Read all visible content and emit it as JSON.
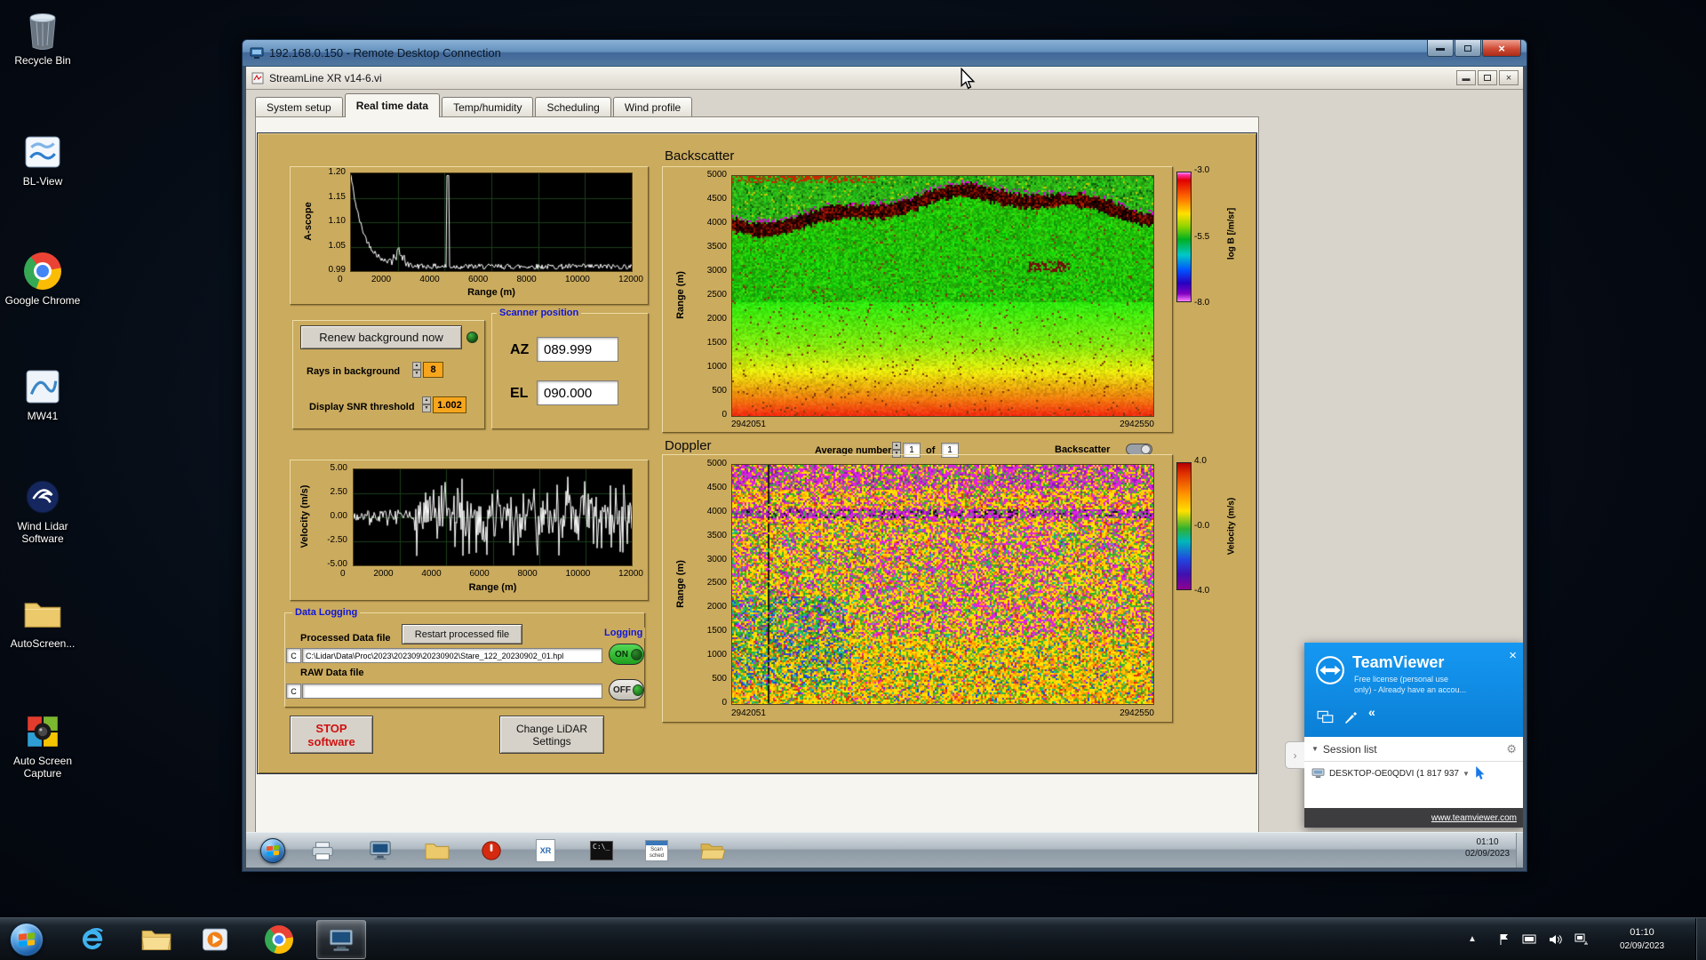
{
  "desktop": {
    "icons": [
      {
        "label": "Recycle Bin"
      },
      {
        "label": "BL-View"
      },
      {
        "label": "Google Chrome"
      },
      {
        "label": "MW41"
      },
      {
        "label": "Wind Lidar Software"
      },
      {
        "label": "AutoScreen..."
      },
      {
        "label": "Auto Screen Capture"
      }
    ]
  },
  "rdp": {
    "title": "192.168.0.150 - Remote Desktop Connection",
    "app_title": "StreamLine XR v14-6.vi",
    "tabs": [
      "System setup",
      "Real time data",
      "Temp/humidity",
      "Scheduling",
      "Wind profile"
    ],
    "active_tab": "Real time data"
  },
  "panel": {
    "backscatter_heading": "Backscatter",
    "doppler_heading": "Doppler",
    "renew_button": "Renew background now",
    "rays_label": "Rays in background",
    "rays_value": "8",
    "snr_label": "Display SNR threshold",
    "snr_value": "1.002",
    "scanner": {
      "title": "Scanner position",
      "az_label": "AZ",
      "az_value": "089.999",
      "el_label": "EL",
      "el_value": "090.000"
    },
    "average": {
      "label": "Average number",
      "first": "1",
      "of": "of",
      "second": "1"
    },
    "backscatter_toggle_label": "Backscatter",
    "logging": {
      "title": "Data Logging",
      "processed_label": "Processed Data file",
      "restart_button": "Restart processed file",
      "logging_label": "Logging",
      "drive": "C",
      "processed_path": "C:\\Lidar\\Data\\Proc\\2023\\202309\\20230902\\Stare_122_20230902_01.hpl",
      "on_label": "ON",
      "raw_label": "RAW Data file",
      "raw_path": "",
      "off_label": "OFF"
    },
    "stop_button": "STOP software",
    "change_button": "Change LiDAR Settings"
  },
  "charts": {
    "ascope": {
      "type": "line",
      "ylabel": "A-scope",
      "xlabel": "Range (m)",
      "yticks": [
        "1.20",
        "1.15",
        "1.10",
        "1.05",
        "0.99"
      ],
      "xticks": [
        "0",
        "2000",
        "4000",
        "6000",
        "8000",
        "10000",
        "12000"
      ]
    },
    "velocity": {
      "type": "line",
      "ylabel": "Velocity (m/s)",
      "xlabel": "Range (m)",
      "yticks": [
        "5.00",
        "2.50",
        "0.00",
        "-2.50",
        "-5.00"
      ],
      "xticks": [
        "0",
        "2000",
        "4000",
        "6000",
        "8000",
        "10000",
        "12000"
      ]
    },
    "backscatter_map": {
      "type": "heatmap",
      "ylabel": "Range (m)",
      "yticks": [
        "5000",
        "4500",
        "4000",
        "3500",
        "3000",
        "2500",
        "2000",
        "1500",
        "1000",
        "500",
        "0"
      ],
      "xticks": [
        "2942051",
        "2942550"
      ],
      "colorbar": {
        "label": "log B [/m/sr]",
        "ticks": [
          "-3.0",
          "-5.5",
          "-8.0"
        ]
      }
    },
    "doppler_map": {
      "type": "heatmap",
      "ylabel": "Range (m)",
      "yticks": [
        "5000",
        "4500",
        "4000",
        "3500",
        "3000",
        "2500",
        "2000",
        "1500",
        "1000",
        "500",
        "0"
      ],
      "xticks": [
        "2942051",
        "2942550"
      ],
      "colorbar": {
        "label": "Velocity (m/s)",
        "ticks": [
          "4.0",
          "-0.0",
          "-4.0"
        ]
      }
    }
  },
  "remote_taskbar": {
    "time": "01:10",
    "date": "02/09/2023"
  },
  "teamviewer": {
    "title": "TeamViewer",
    "license_line1": "Free license (personal use",
    "license_line2": "only) - Already have an accou...",
    "session_list": "Session list",
    "computer": "DESKTOP-OE0QDVI (1 817 937",
    "url": "www.teamviewer.com"
  },
  "host_taskbar": {
    "time": "01:10",
    "date": "02/09/2023"
  }
}
